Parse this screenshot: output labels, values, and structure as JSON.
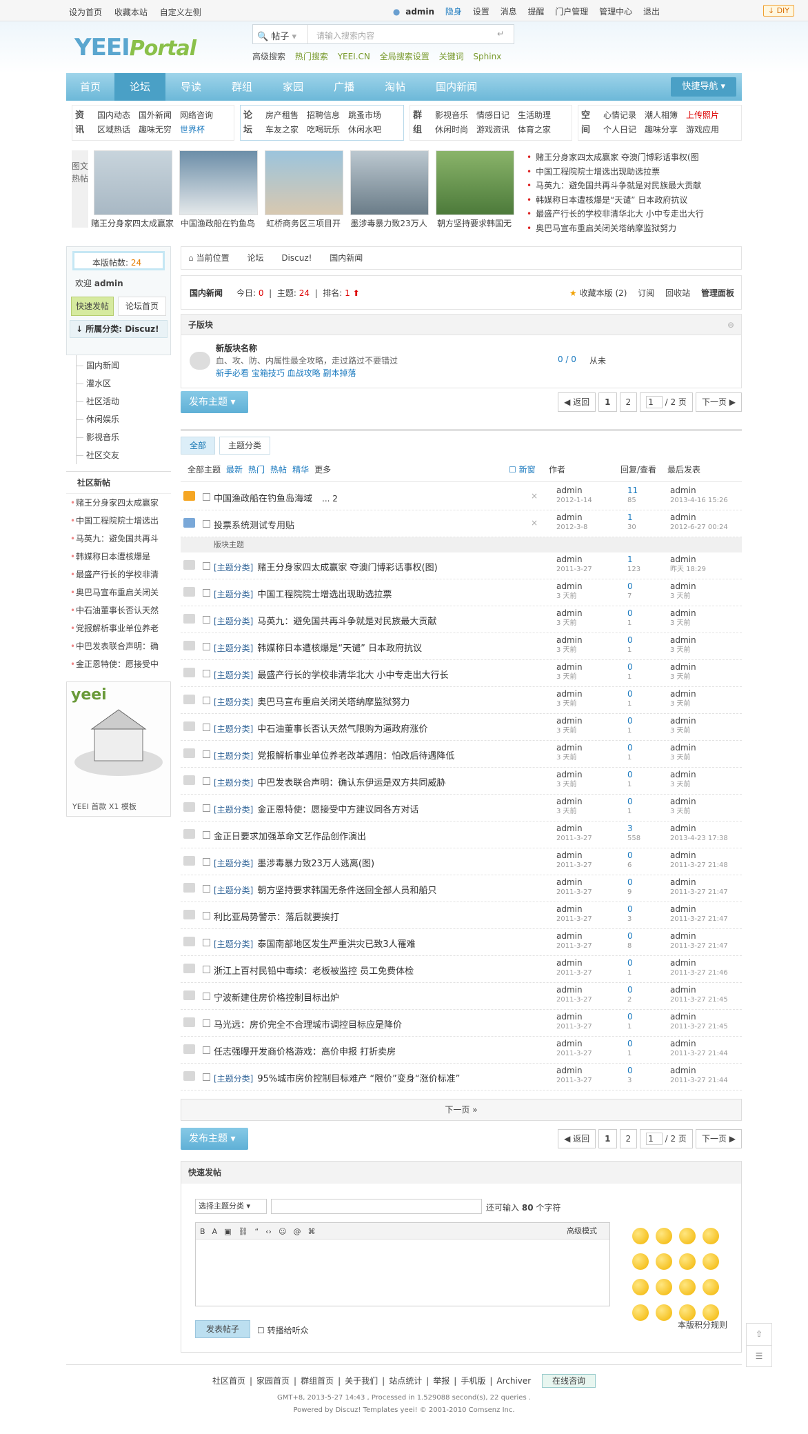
{
  "top": {
    "left": [
      "设为首页",
      "收藏本站",
      "自定义左侧"
    ],
    "user": "admin",
    "right": [
      "隐身",
      "设置",
      "消息",
      "提醒",
      "门户管理",
      "管理中心",
      "退出"
    ],
    "diy": "DIY"
  },
  "logo": {
    "a": "YEEI",
    "b": "Portal"
  },
  "search": {
    "type": "帖子",
    "placeholder": "请输入搜索内容",
    "label": "高级搜索",
    "hot": [
      "热门搜索",
      "YEEI.CN",
      "全局搜索设置",
      "关键词",
      "Sphinx"
    ]
  },
  "nav": {
    "items": [
      "首页",
      "论坛",
      "导读",
      "群组",
      "家园",
      "广播",
      "淘帖",
      "国内新闻"
    ],
    "quick": "快捷导航"
  },
  "portal": {
    "g1": {
      "h": "资讯",
      "links": [
        "国内动态",
        "国外新闻",
        "网络咨询",
        "区域热话",
        "趣味无穷",
        "世界杯"
      ]
    },
    "g2": {
      "h": "论坛",
      "links": [
        "房产租售",
        "招聘信息",
        "跳蚤市场",
        "车友之家",
        "吃喝玩乐",
        "休闲水吧"
      ]
    },
    "g3": {
      "h": "群组",
      "links": [
        "影视音乐",
        "情感日记",
        "生活助理",
        "休闲时尚",
        "游戏资讯",
        "体育之家"
      ]
    },
    "g4": {
      "h": "空间",
      "links": [
        "心情记录",
        "潮人相簿",
        "上传照片",
        "个人日记",
        "趣味分享",
        "游戏应用"
      ]
    }
  },
  "hot": {
    "tag": "图文热帖",
    "pics": [
      "赌王分身家四太成赢家",
      "中国渔政船在钓鱼岛",
      "虹桥商务区三项目开",
      "墨涉毒暴力致23万人",
      "朝方坚持要求韩国无"
    ],
    "list": [
      "赌王分身家四太成赢家 夺澳门博彩话事权(图",
      "中国工程院院士增选出现助选拉票",
      "马英九：避免国共再斗争就是对民族最大贡献",
      "韩媒称日本遭核爆是“天谴” 日本政府抗议",
      "最盛产行长的学校非清华北大 小中专走出大行",
      "奥巴马宣布重启关闭关塔纳摩监狱努力"
    ]
  },
  "side": {
    "count_label": "本版帖数:",
    "count": "24",
    "welcome": "欢迎",
    "user": "admin",
    "quickpost": "快速发帖",
    "forumhome": "论坛首页",
    "cat": "所属分类: Discuz!",
    "forums": [
      "国内新闻",
      "灌水区",
      "社区活动",
      "休闲娱乐",
      "影视音乐",
      "社区交友"
    ],
    "new_h": "社区新帖",
    "new": [
      "赌王分身家四太成赢家",
      "中国工程院院士增选出",
      "马英九：避免国共再斗",
      "韩媒称日本遭核爆是",
      "最盛产行长的学校非清",
      "奥巴马宣布重启关闭关",
      "中石油董事长否认天然",
      "党报解析事业单位养老",
      "中巴发表联合声明：确",
      "金正恩特使：愿接受中"
    ],
    "ad": "YEEI 首款 X1 模板"
  },
  "bread": [
    "当前位置",
    "论坛",
    "Discuz!",
    "国内新闻"
  ],
  "fhead": {
    "title": "国内新闻",
    "today_l": "今日:",
    "today": "0",
    "topics_l": "主题:",
    "topics": "24",
    "rank_l": "排名:",
    "rank": "1",
    "acts": [
      "收藏本版 (2)",
      "订阅",
      "回收站",
      "管理面板"
    ]
  },
  "sub": {
    "h": "子版块",
    "name": "新版块名称",
    "desc": "血、攻、防、内属性最全攻略，走过路过不要错过",
    "links": "新手必看 宝箱技巧 血战攻略 副本掉落",
    "stat": "0 / 0",
    "last": "从未"
  },
  "post": "发布主题",
  "pager": {
    "back": "返回",
    "p1": "1",
    "p2": "2",
    "cur": "1",
    "total": "/ 2 页",
    "next": "下一页"
  },
  "tabs": [
    "全部",
    "主题分类"
  ],
  "thead": {
    "filters": [
      "全部主题",
      "最新",
      "热门",
      "热帖",
      "精华",
      "更多"
    ],
    "newwin": "新窗",
    "author": "作者",
    "rv": "回复/查看",
    "last": "最后发表"
  },
  "sticky": [
    {
      "t": "中国渔政船在钓鱼岛海域",
      "extra": "... 2",
      "a": "admin",
      "d": "2012-1-14",
      "r": "11",
      "v": "85",
      "l": "admin",
      "ld": "2013-4-16 15:26"
    },
    {
      "t": "投票系统测试专用贴",
      "extra": "",
      "a": "admin",
      "d": "2012-3-8",
      "r": "1",
      "v": "30",
      "l": "admin",
      "ld": "2012-6-27 00:24"
    }
  ],
  "sep": "版块主题",
  "threads": [
    {
      "ty": "[主题分类]",
      "t": "赌王分身家四太成赢家 夺澳门博彩话事权(图)",
      "a": "admin",
      "d": "2011-3-27",
      "r": "1",
      "v": "123",
      "l": "admin",
      "ld": "昨天 18:29"
    },
    {
      "ty": "[主题分类]",
      "t": "中国工程院院士增选出现助选拉票",
      "a": "admin",
      "d": "3 天前",
      "r": "0",
      "v": "7",
      "l": "admin",
      "ld": "3 天前"
    },
    {
      "ty": "[主题分类]",
      "t": "马英九：避免国共再斗争就是对民族最大贡献",
      "a": "admin",
      "d": "3 天前",
      "r": "0",
      "v": "1",
      "l": "admin",
      "ld": "3 天前"
    },
    {
      "ty": "[主题分类]",
      "t": "韩媒称日本遭核爆是“天谴” 日本政府抗议",
      "a": "admin",
      "d": "3 天前",
      "r": "0",
      "v": "1",
      "l": "admin",
      "ld": "3 天前"
    },
    {
      "ty": "[主题分类]",
      "t": "最盛产行长的学校非清华北大 小中专走出大行长",
      "a": "admin",
      "d": "3 天前",
      "r": "0",
      "v": "1",
      "l": "admin",
      "ld": "3 天前"
    },
    {
      "ty": "[主题分类]",
      "t": "奥巴马宣布重启关闭关塔纳摩监狱努力",
      "a": "admin",
      "d": "3 天前",
      "r": "0",
      "v": "1",
      "l": "admin",
      "ld": "3 天前"
    },
    {
      "ty": "[主题分类]",
      "t": "中石油董事长否认天然气限购为逼政府涨价",
      "a": "admin",
      "d": "3 天前",
      "r": "0",
      "v": "1",
      "l": "admin",
      "ld": "3 天前"
    },
    {
      "ty": "[主题分类]",
      "t": "党报解析事业单位养老改革遇阻：怕改后待遇降低",
      "a": "admin",
      "d": "3 天前",
      "r": "0",
      "v": "1",
      "l": "admin",
      "ld": "3 天前"
    },
    {
      "ty": "[主题分类]",
      "t": "中巴发表联合声明：确认东伊运是双方共同威胁",
      "a": "admin",
      "d": "3 天前",
      "r": "0",
      "v": "1",
      "l": "admin",
      "ld": "3 天前"
    },
    {
      "ty": "[主题分类]",
      "t": "金正恩特使：愿接受中方建议同各方对话",
      "a": "admin",
      "d": "3 天前",
      "r": "0",
      "v": "1",
      "l": "admin",
      "ld": "3 天前"
    },
    {
      "ty": "",
      "t": "金正日要求加强革命文艺作品创作演出",
      "a": "admin",
      "d": "2011-3-27",
      "r": "3",
      "v": "558",
      "l": "admin",
      "ld": "2013-4-23 17:38"
    },
    {
      "ty": "[主题分类]",
      "t": "墨涉毒暴力致23万人逃离(图)",
      "a": "admin",
      "d": "2011-3-27",
      "r": "0",
      "v": "6",
      "l": "admin",
      "ld": "2011-3-27 21:48"
    },
    {
      "ty": "[主题分类]",
      "t": "朝方坚持要求韩国无条件送回全部人员和船只",
      "a": "admin",
      "d": "2011-3-27",
      "r": "0",
      "v": "9",
      "l": "admin",
      "ld": "2011-3-27 21:47"
    },
    {
      "ty": "",
      "t": "利比亚局势警示：落后就要挨打",
      "a": "admin",
      "d": "2011-3-27",
      "r": "0",
      "v": "3",
      "l": "admin",
      "ld": "2011-3-27 21:47"
    },
    {
      "ty": "[主题分类]",
      "t": "泰国南部地区发生严重洪灾已致3人罹难",
      "a": "admin",
      "d": "2011-3-27",
      "r": "0",
      "v": "8",
      "l": "admin",
      "ld": "2011-3-27 21:47"
    },
    {
      "ty": "",
      "t": "浙江上百村民铅中毒续：老板被监控 员工免费体检",
      "a": "admin",
      "d": "2011-3-27",
      "r": "0",
      "v": "1",
      "l": "admin",
      "ld": "2011-3-27 21:46"
    },
    {
      "ty": "",
      "t": "宁波新建住房价格控制目标出炉",
      "a": "admin",
      "d": "2011-3-27",
      "r": "0",
      "v": "2",
      "l": "admin",
      "ld": "2011-3-27 21:45"
    },
    {
      "ty": "",
      "t": "马光远：房价完全不合理城市调控目标应是降价",
      "a": "admin",
      "d": "2011-3-27",
      "r": "0",
      "v": "1",
      "l": "admin",
      "ld": "2011-3-27 21:45"
    },
    {
      "ty": "",
      "t": "任志强曝开发商价格游戏：高价申报 打折卖房",
      "a": "admin",
      "d": "2011-3-27",
      "r": "0",
      "v": "1",
      "l": "admin",
      "ld": "2011-3-27 21:44"
    },
    {
      "ty": "[主题分类]",
      "t": "95%城市房价控制目标难产 “限价”变身“涨价标准”",
      "a": "admin",
      "d": "2011-3-27",
      "r": "0",
      "v": "3",
      "l": "admin",
      "ld": "2011-3-27 21:44"
    }
  ],
  "nextpage": "下一页 »",
  "fast": {
    "h": "快速发帖",
    "sel": "选择主题分类",
    "lim_a": "还可输入",
    "lim_n": "80",
    "lim_b": "个字符",
    "adv": "高级模式",
    "submit": "发表帖子",
    "bcast": "转播给听众",
    "rule": "本版积分规则"
  },
  "footer": {
    "links": [
      "社区首页",
      "家园首页",
      "群组首页",
      "关于我们",
      "站点统计",
      "举报",
      "手机版",
      "Archiver"
    ],
    "online": "在线咨询",
    "line1": "GMT+8, 2013-5-27 14:43 , Processed in 1.529088 second(s), 22 queries .",
    "line2": "Powered by Discuz! Templates yeei! © 2001-2010 Comsenz Inc."
  }
}
